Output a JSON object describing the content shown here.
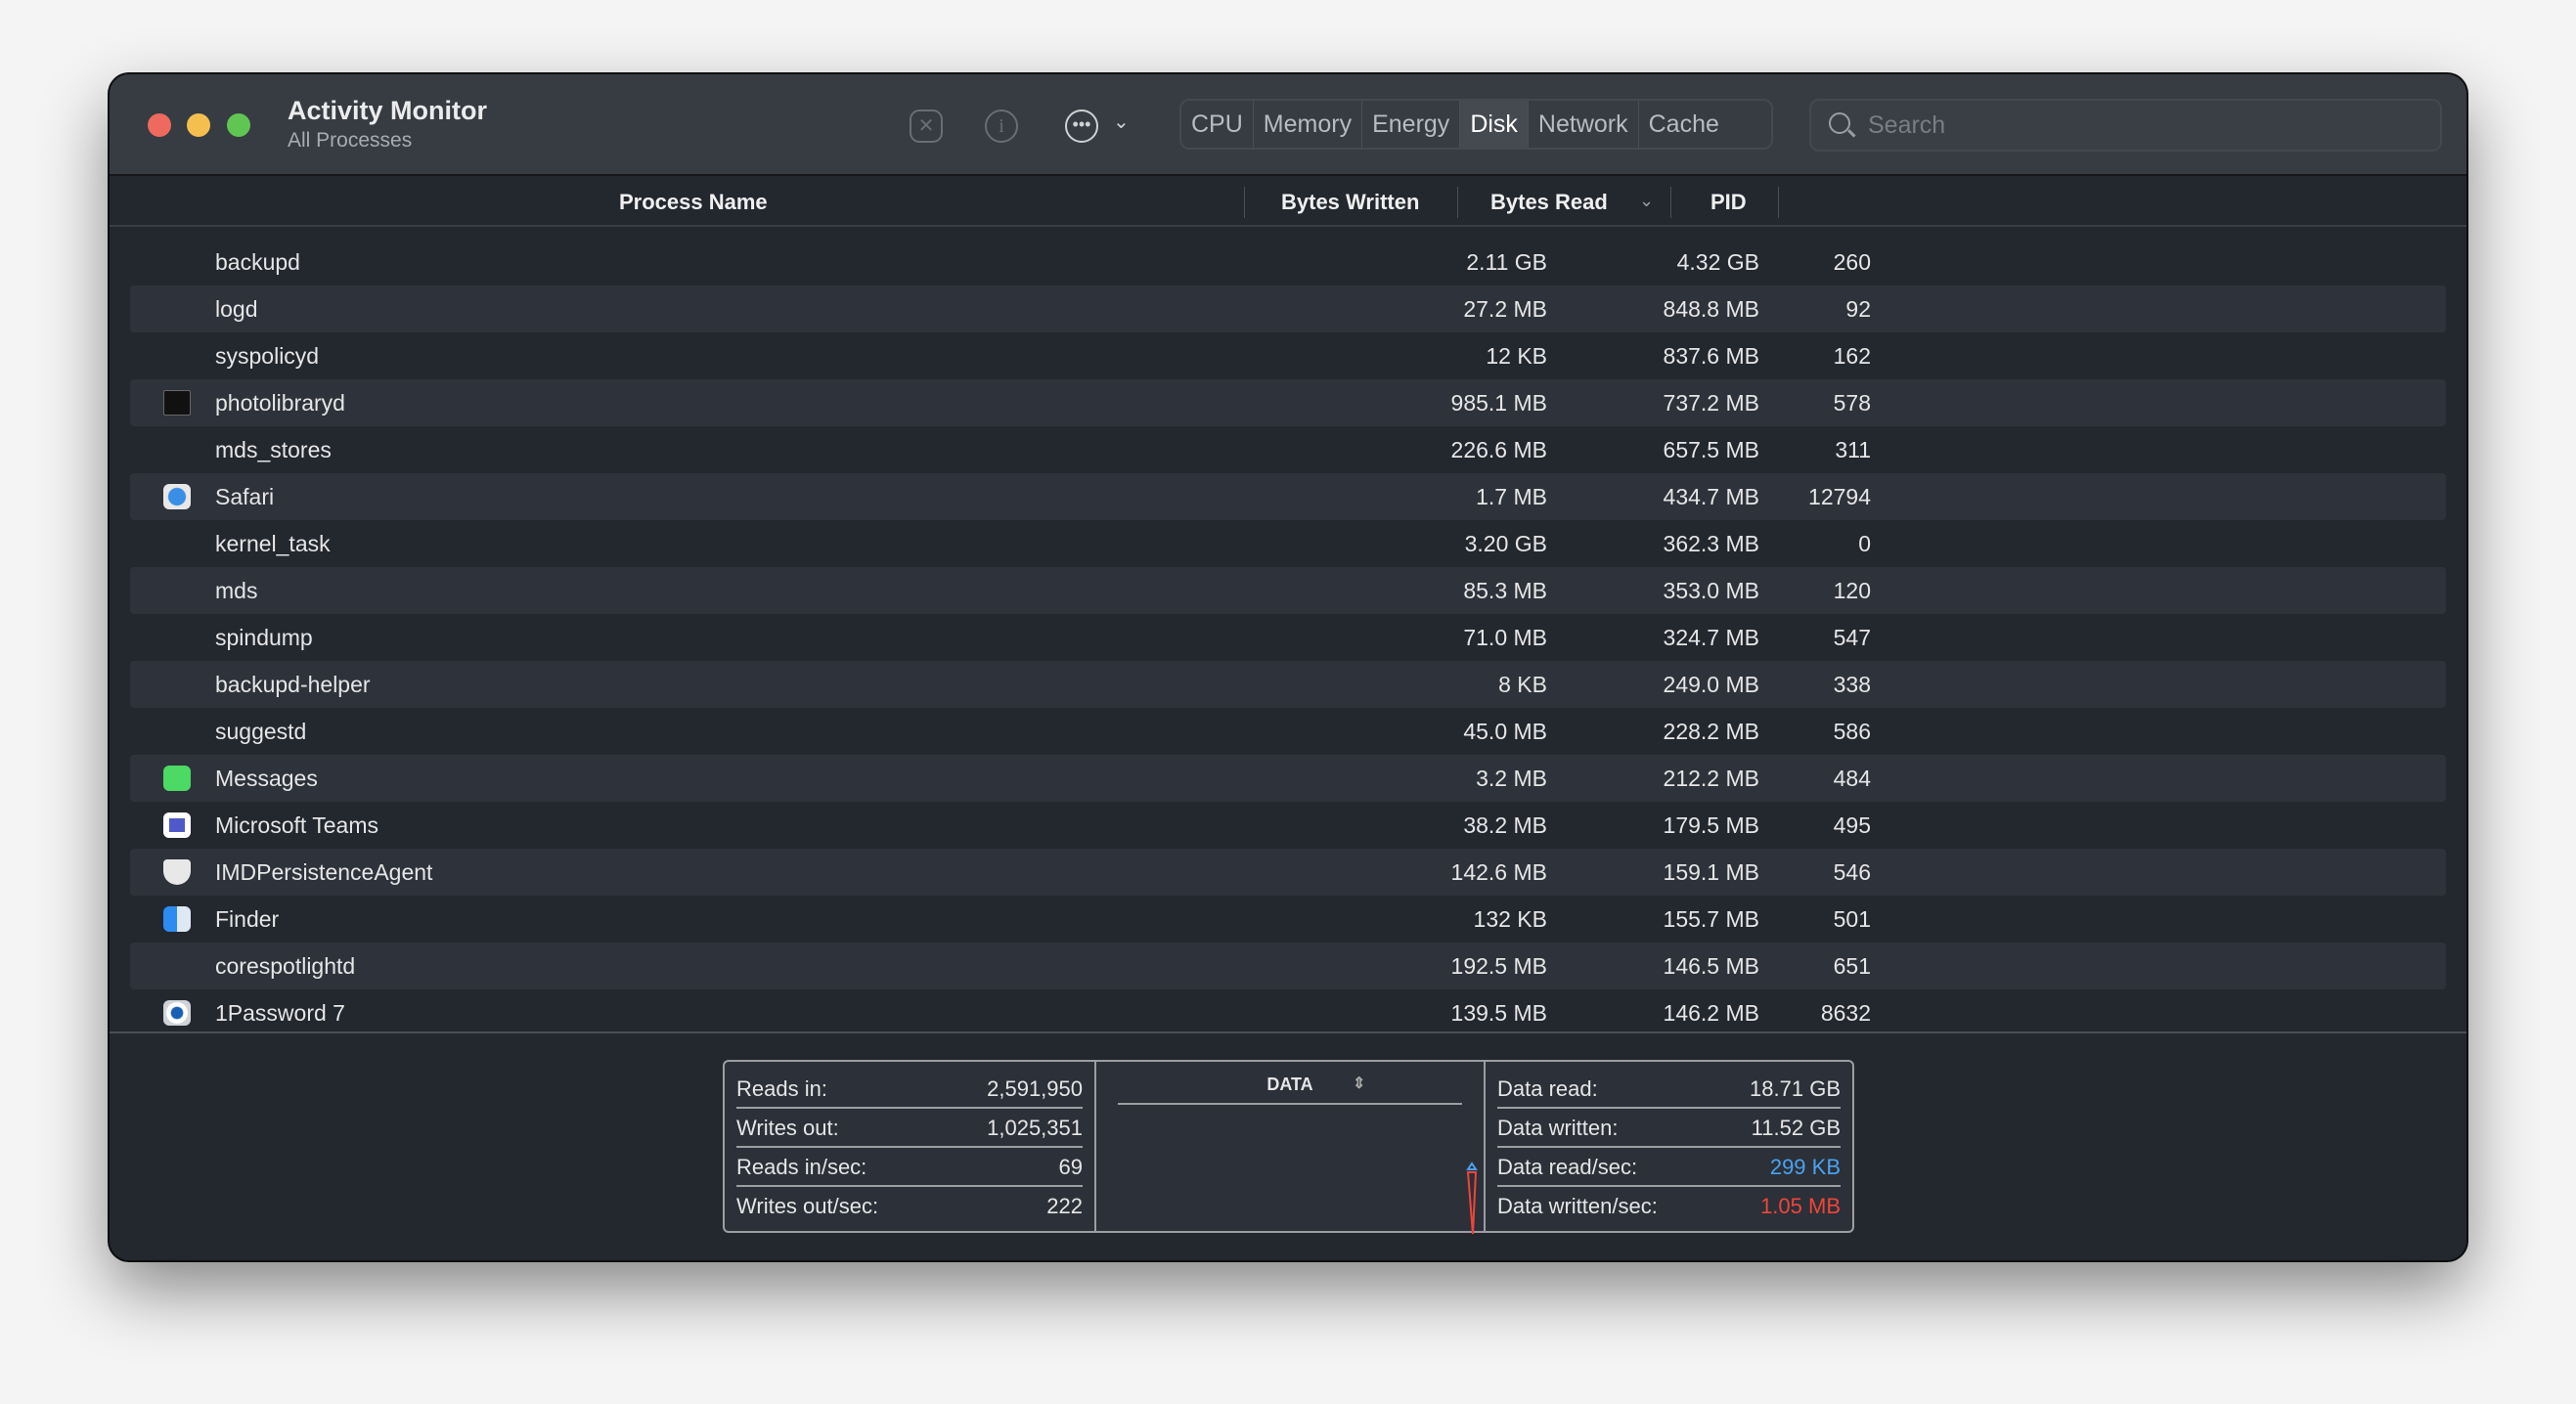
{
  "window": {
    "title": "Activity Monitor",
    "subtitle": "All Processes"
  },
  "toolbar": {
    "icons": [
      "stop-process-icon",
      "info-icon",
      "more-options-icon",
      "chevron-down-icon"
    ],
    "tabs": [
      {
        "label": "CPU"
      },
      {
        "label": "Memory"
      },
      {
        "label": "Energy"
      },
      {
        "label": "Disk",
        "active": true
      },
      {
        "label": "Network"
      },
      {
        "label": "Cache"
      }
    ],
    "search_placeholder": "Search"
  },
  "table": {
    "columns": [
      "Process Name",
      "Bytes Written",
      "Bytes Read",
      "PID"
    ],
    "sort_column": "Bytes Read",
    "sort_direction": "descending",
    "rows": [
      {
        "name": "backupd",
        "icon": "",
        "written": "2.11 GB",
        "read": "4.32 GB",
        "pid": "260"
      },
      {
        "name": "logd",
        "icon": "",
        "written": "27.2 MB",
        "read": "848.8 MB",
        "pid": "92"
      },
      {
        "name": "syspolicyd",
        "icon": "",
        "written": "12 KB",
        "read": "837.6 MB",
        "pid": "162"
      },
      {
        "name": "photolibraryd",
        "icon": "terminal-icon",
        "written": "985.1 MB",
        "read": "737.2 MB",
        "pid": "578"
      },
      {
        "name": "mds_stores",
        "icon": "",
        "written": "226.6 MB",
        "read": "657.5 MB",
        "pid": "311"
      },
      {
        "name": "Safari",
        "icon": "safari-icon",
        "written": "1.7 MB",
        "read": "434.7 MB",
        "pid": "12794"
      },
      {
        "name": "kernel_task",
        "icon": "",
        "written": "3.20 GB",
        "read": "362.3 MB",
        "pid": "0"
      },
      {
        "name": "mds",
        "icon": "",
        "written": "85.3 MB",
        "read": "353.0 MB",
        "pid": "120"
      },
      {
        "name": "spindump",
        "icon": "",
        "written": "71.0 MB",
        "read": "324.7 MB",
        "pid": "547"
      },
      {
        "name": "backupd-helper",
        "icon": "",
        "written": "8 KB",
        "read": "249.0 MB",
        "pid": "338"
      },
      {
        "name": "suggestd",
        "icon": "",
        "written": "45.0 MB",
        "read": "228.2 MB",
        "pid": "586"
      },
      {
        "name": "Messages",
        "icon": "messages-icon",
        "written": "3.2 MB",
        "read": "212.2 MB",
        "pid": "484"
      },
      {
        "name": "Microsoft Teams",
        "icon": "teams-icon",
        "written": "38.2 MB",
        "read": "179.5 MB",
        "pid": "495"
      },
      {
        "name": "IMDPersistenceAgent",
        "icon": "shield-icon",
        "written": "142.6 MB",
        "read": "159.1 MB",
        "pid": "546"
      },
      {
        "name": "Finder",
        "icon": "finder-icon",
        "written": "132 KB",
        "read": "155.7 MB",
        "pid": "501"
      },
      {
        "name": "corespotlightd",
        "icon": "",
        "written": "192.5 MB",
        "read": "146.5 MB",
        "pid": "651"
      },
      {
        "name": "1Password 7",
        "icon": "1password-icon",
        "written": "139.5 MB",
        "read": "146.2 MB",
        "pid": "8632"
      }
    ]
  },
  "summary": {
    "left": [
      {
        "label": "Reads in:",
        "value": "2,591,950"
      },
      {
        "label": "Writes out:",
        "value": "1,025,351"
      },
      {
        "label": "Reads in/sec:",
        "value": "69"
      },
      {
        "label": "Writes out/sec:",
        "value": "222"
      }
    ],
    "graph_title": "DATA",
    "right": [
      {
        "label": "Data read:",
        "value": "18.71 GB"
      },
      {
        "label": "Data written:",
        "value": "11.52 GB"
      },
      {
        "label": "Data read/sec:",
        "value": "299 KB",
        "color": "#4aa3f0"
      },
      {
        "label": "Data written/sec:",
        "value": "1.05 MB",
        "color": "#f0453a"
      }
    ]
  },
  "colors": {
    "close": "#ee6a5f",
    "minimize": "#f5bf4f",
    "zoom": "#61c554",
    "read": "#4aa3f0",
    "write": "#f0453a"
  }
}
